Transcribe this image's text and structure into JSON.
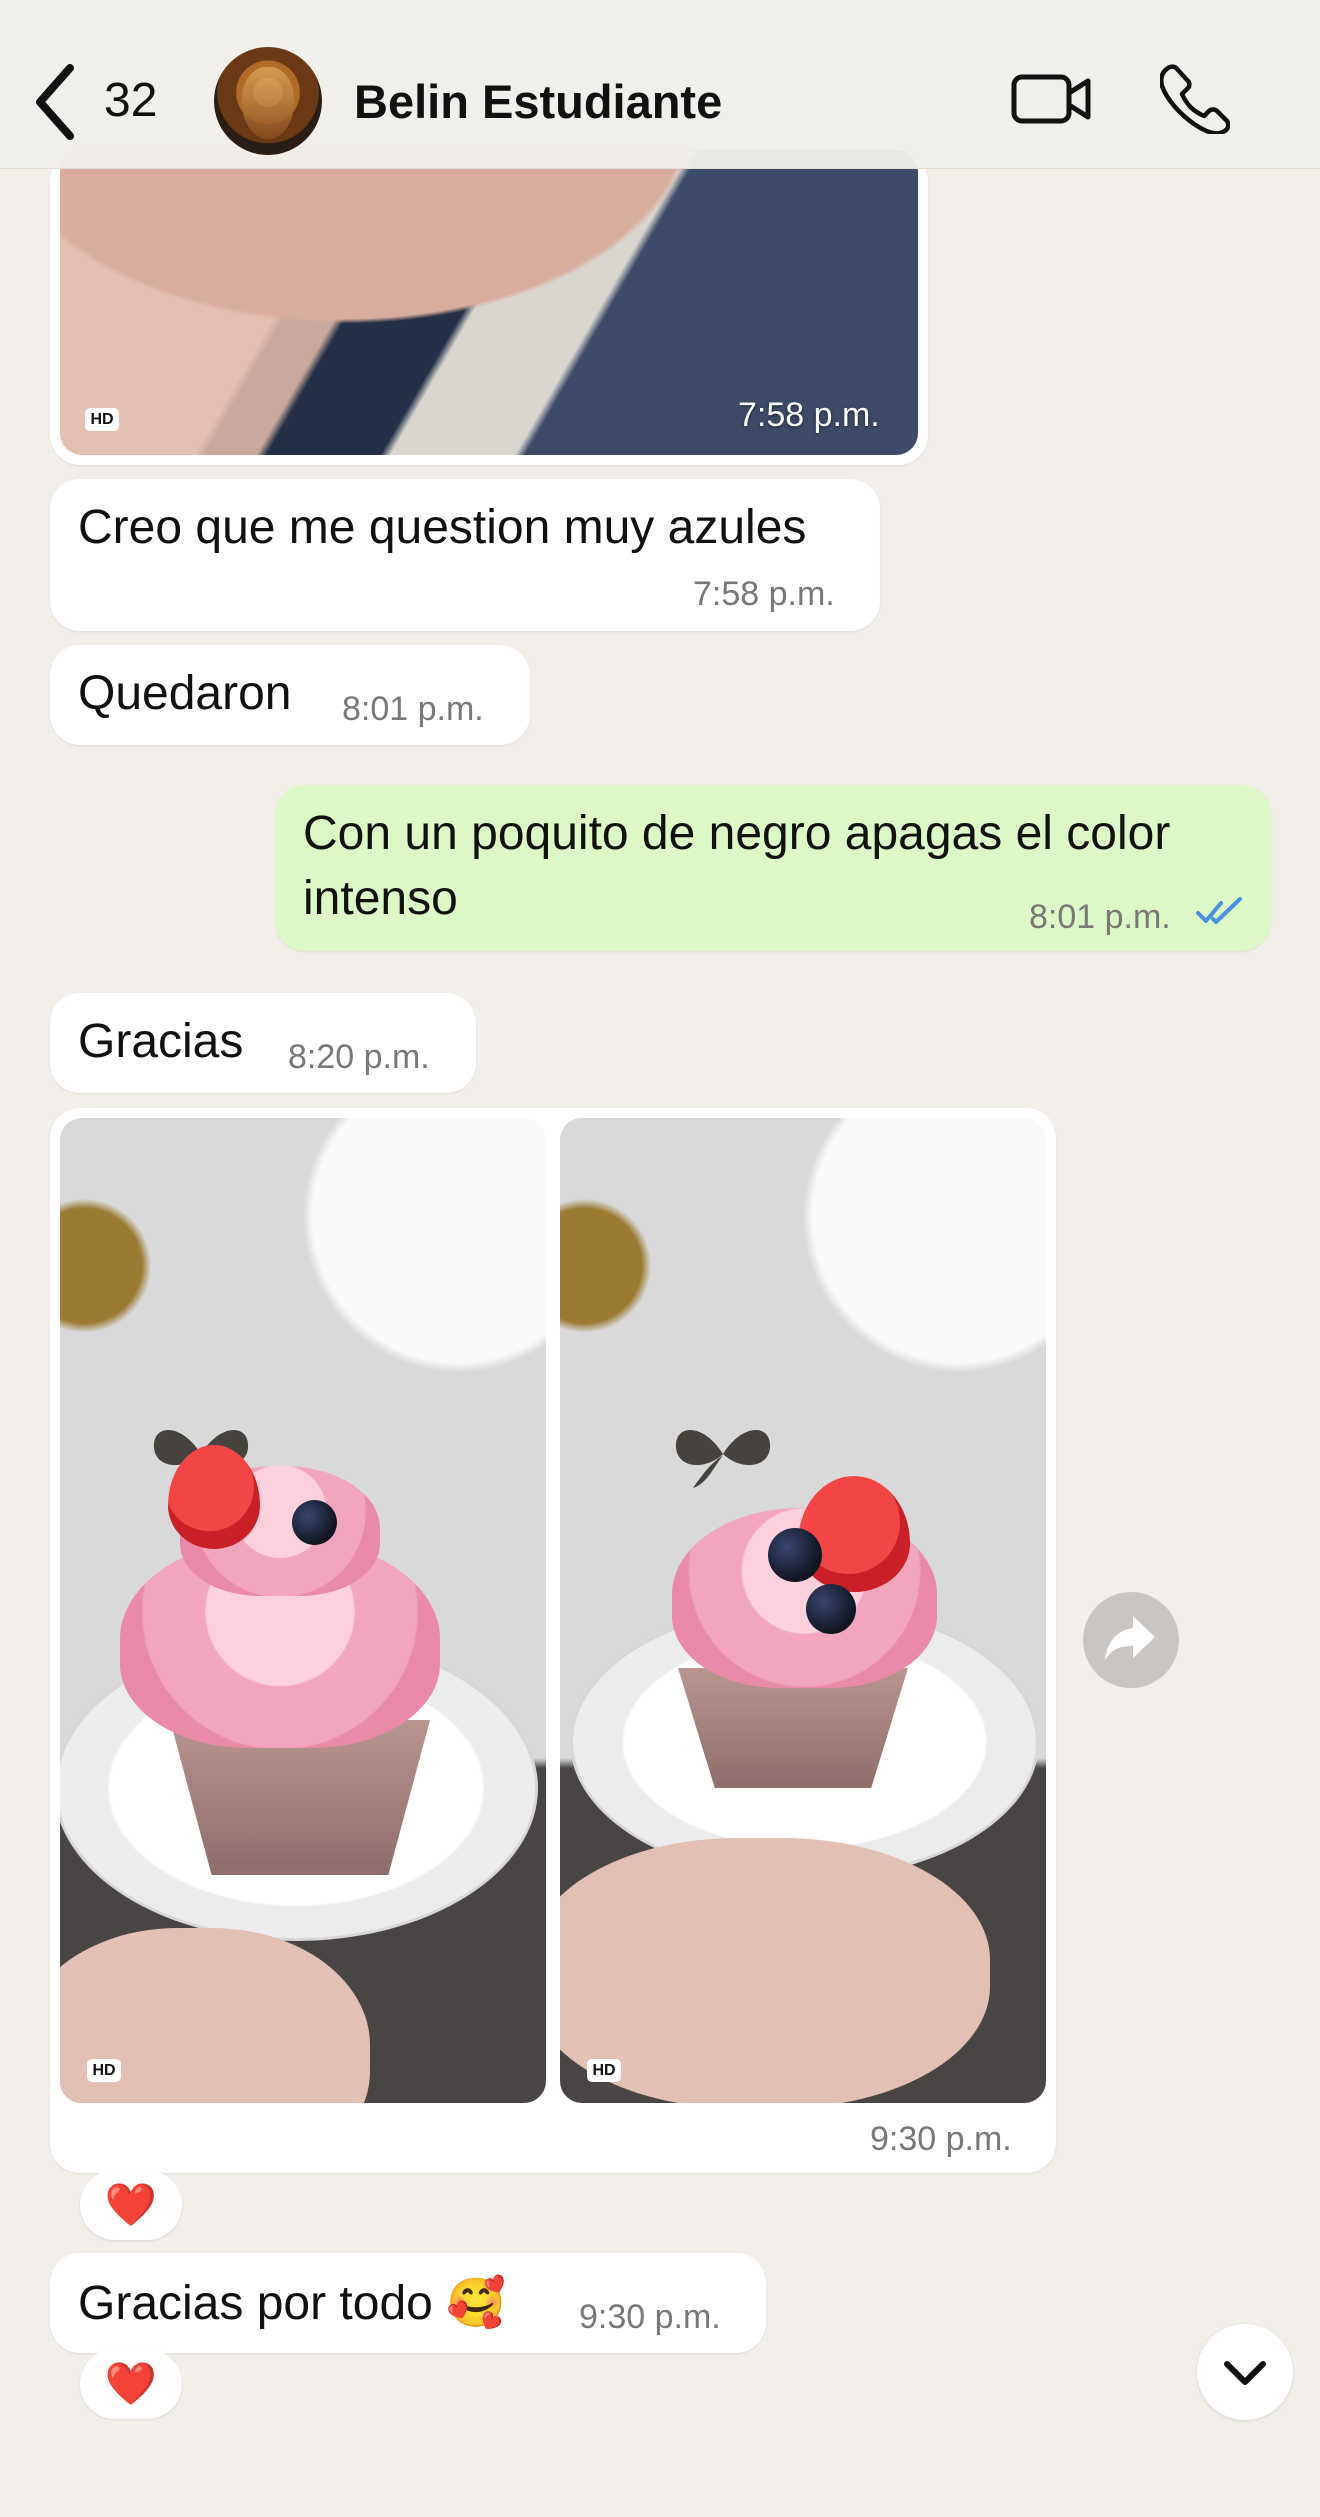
{
  "header": {
    "back_count": "32",
    "contact_name": "Belin Estudiante",
    "video_icon": "video-camera-icon",
    "call_icon": "phone-icon"
  },
  "messages": [
    {
      "id": "m1",
      "type": "image",
      "direction": "received",
      "time": "7:58 p.m.",
      "hd_label": "HD"
    },
    {
      "id": "m2",
      "type": "text",
      "direction": "received",
      "text": "Creo que me question muy azules",
      "time": "7:58 p.m."
    },
    {
      "id": "m3",
      "type": "text",
      "direction": "received",
      "text": "Quedaron",
      "time": "8:01 p.m."
    },
    {
      "id": "m4",
      "type": "text",
      "direction": "sent",
      "text_lines": [
        "Con un poquito de negro apagas el color",
        "intenso"
      ],
      "time": "8:01 p.m.",
      "status": "read"
    },
    {
      "id": "m5",
      "type": "text",
      "direction": "received",
      "text": "Gracias",
      "time": "8:20 p.m."
    },
    {
      "id": "m6",
      "type": "image_group",
      "direction": "received",
      "time": "9:30 p.m.",
      "hd_labels": [
        "HD",
        "HD"
      ],
      "reaction": "❤️"
    },
    {
      "id": "m7",
      "type": "text",
      "direction": "received",
      "text": "Gracias por todo 🥰",
      "time": "9:30 p.m.",
      "reaction": "❤️"
    }
  ],
  "colors": {
    "background": "#f2efea",
    "received_bubble": "#ffffff",
    "sent_bubble": "#dcf8c6",
    "read_receipt": "#4a90e2",
    "heart": "#e0212d"
  },
  "icons": {
    "back": "chevron-left-icon",
    "forward": "share-forward-icon",
    "scroll_down": "chevron-down-icon"
  }
}
